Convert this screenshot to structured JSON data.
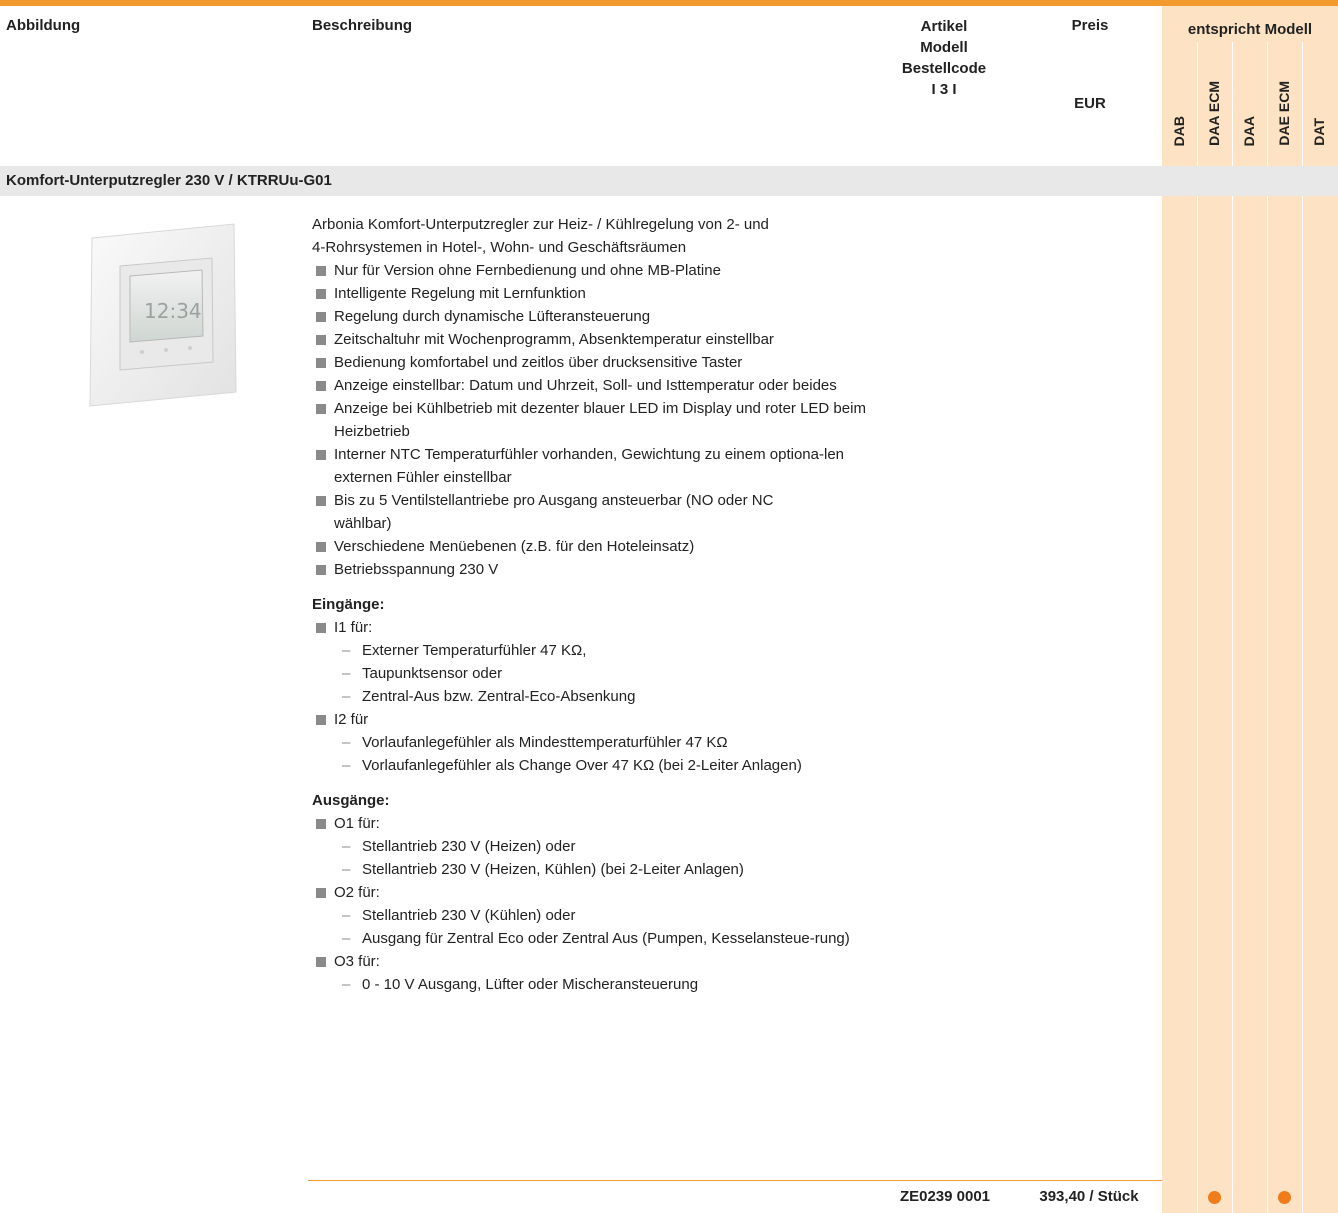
{
  "header": {
    "col_image": "Abbildung",
    "col_description": "Beschreibung",
    "col_article_line1": "Artikel",
    "col_article_line2": "Modell",
    "col_article_line3": "Bestellcode",
    "col_article_line4": "I 3 I",
    "col_price_line1": "Preis",
    "col_price_line2": "EUR",
    "col_models": "entspricht Modell",
    "models": [
      "DAB",
      "DAA ECM",
      "DAA",
      "DAE ECM",
      "DAT"
    ]
  },
  "section": {
    "title": "Komfort-Unterputzregler 230 V / KTRRUu-G01"
  },
  "product": {
    "device_display": "12:34",
    "intro_line1": "Arbonia Komfort-Unterputzregler zur Heiz- / Kühlregelung von 2- und",
    "intro_line2": "4-Rohrsystemen in Hotel-, Wohn- und Geschäftsräumen",
    "features": [
      "Nur für Version ohne Fernbedienung und ohne MB-Platine",
      "Intelligente Regelung mit Lernfunktion",
      "Regelung durch dynamische Lüfteransteuerung",
      "Zeitschaltuhr mit Wochenprogramm, Absenktemperatur einstellbar",
      "Bedienung komfortabel und zeitlos über drucksensitive Taster",
      "Anzeige einstellbar: Datum und Uhrzeit, Soll- und Isttemperatur oder beides",
      "Anzeige bei Kühlbetrieb mit dezenter blauer LED im Display und roter LED beim Heizbetrieb",
      "Interner NTC Temperaturfühler vorhanden, Gewichtung zu einem optiona-len externen Fühler einstellbar",
      "Bis zu 5 Ventilstellantriebe pro Ausgang ansteuerbar (NO oder NC wählbar)",
      "Verschiedene Menüebenen  (z.B. für den Hoteleinsatz)",
      "Betriebsspannung 230 V"
    ],
    "inputs_title": "Eingänge:",
    "input1_label": "I1 für:",
    "input1_items": [
      "Externer Temperaturfühler 47 KΩ,",
      "Taupunktsensor oder",
      "Zentral-Aus bzw. Zentral-Eco-Absenkung"
    ],
    "input2_label": "I2 für",
    "input2_items": [
      "Vorlaufanlegefühler als Mindesttemperaturfühler 47 KΩ",
      "Vorlaufanlegefühler als Change Over 47 KΩ (bei 2-Leiter Anlagen)"
    ],
    "outputs_title": "Ausgänge:",
    "output1_label": "O1 für:",
    "output1_items": [
      "Stellantrieb 230 V (Heizen) oder",
      "Stellantrieb 230 V (Heizen, Kühlen) (bei 2-Leiter Anlagen)"
    ],
    "output2_label": "O2 für:",
    "output2_items": [
      "Stellantrieb 230 V (Kühlen) oder",
      "Ausgang für Zentral Eco oder Zentral Aus (Pumpen, Kesselansteue-rung)"
    ],
    "output3_label": "O3 für:",
    "output3_items": [
      "0 - 10 V Ausgang, Lüfter oder Mischeransteuerung"
    ],
    "order_code": "ZE0239 0001",
    "price": "393,40 / Stück",
    "model_match": [
      false,
      true,
      false,
      true,
      false
    ]
  },
  "colors": {
    "accent": "#f39a2e",
    "model_bg": "#fde3c4",
    "dot": "#f07c1c",
    "section_bg": "#e8e8e8"
  }
}
